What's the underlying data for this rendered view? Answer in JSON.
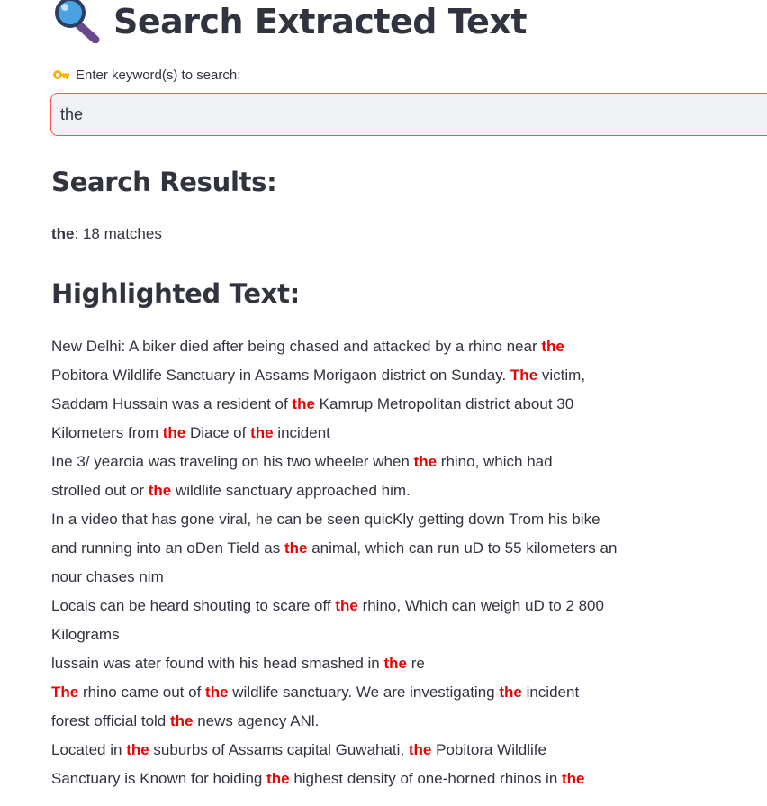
{
  "header": {
    "title": "Search Extracted Text",
    "icon": "magnifying-glass-icon"
  },
  "search": {
    "icon": "key-icon",
    "label": "Enter keyword(s) to search:",
    "value": "the",
    "accent_color": "#ff4b4b"
  },
  "results": {
    "heading": "Search Results:",
    "keyword": "the",
    "summary": ": 18 matches"
  },
  "highlighted": {
    "heading": "Highlighted Text:",
    "highlight_color": "#ee0000",
    "lines": [
      [
        {
          "t": "New Delhi: A biker died after being chased and attacked by a rhino near "
        },
        {
          "t": "the",
          "h": true
        }
      ],
      [
        {
          "t": "Pobitora Wildlife Sanctuary in Assams Morigaon district on Sunday. "
        },
        {
          "t": "The",
          "h": true
        },
        {
          "t": " victim,"
        }
      ],
      [
        {
          "t": "Saddam Hussain was a resident of "
        },
        {
          "t": "the",
          "h": true
        },
        {
          "t": " Kamrup Metropolitan district about 30"
        }
      ],
      [
        {
          "t": "Kilometers from "
        },
        {
          "t": "the",
          "h": true
        },
        {
          "t": " Diace of "
        },
        {
          "t": "the",
          "h": true
        },
        {
          "t": " incident"
        }
      ],
      [
        {
          "t": "Ine 3/ yearoia was traveling on his two wheeler when "
        },
        {
          "t": "the",
          "h": true
        },
        {
          "t": " rhino, which had"
        }
      ],
      [
        {
          "t": "strolled out or "
        },
        {
          "t": "the",
          "h": true
        },
        {
          "t": " wildlife sanctuary approached him."
        }
      ],
      [
        {
          "t": "In a video that has gone viral, he can be seen quicKly getting down Trom his bike"
        }
      ],
      [
        {
          "t": "and running into an oDen Tield as "
        },
        {
          "t": "the",
          "h": true
        },
        {
          "t": " animal, which can run uD to 55 kilometers an"
        }
      ],
      [
        {
          "t": "nour chases nim"
        }
      ],
      [
        {
          "t": "Locais can be heard shouting to scare off "
        },
        {
          "t": "the",
          "h": true
        },
        {
          "t": " rhino, Which can weigh uD to 2 800"
        }
      ],
      [
        {
          "t": "Kilograms"
        }
      ],
      [
        {
          "t": "lussain was ater found with his head smashed in "
        },
        {
          "t": "the",
          "h": true
        },
        {
          "t": " re"
        }
      ],
      [
        {
          "t": "The",
          "h": true
        },
        {
          "t": " rhino came out of "
        },
        {
          "t": "the",
          "h": true
        },
        {
          "t": " wildlife sanctuary. We are investigating "
        },
        {
          "t": "the",
          "h": true
        },
        {
          "t": " incident"
        }
      ],
      [
        {
          "t": "forest official told "
        },
        {
          "t": "the",
          "h": true
        },
        {
          "t": " news agency ANl."
        }
      ],
      [
        {
          "t": "Located in "
        },
        {
          "t": "the",
          "h": true
        },
        {
          "t": " suburbs of Assams capital Guwahati, "
        },
        {
          "t": "the",
          "h": true
        },
        {
          "t": " Pobitora Wildlife"
        }
      ],
      [
        {
          "t": "Sanctuary is Known for hoiding "
        },
        {
          "t": "the",
          "h": true
        },
        {
          "t": " highest density of one-horned rhinos in "
        },
        {
          "t": "the",
          "h": true
        }
      ]
    ]
  }
}
